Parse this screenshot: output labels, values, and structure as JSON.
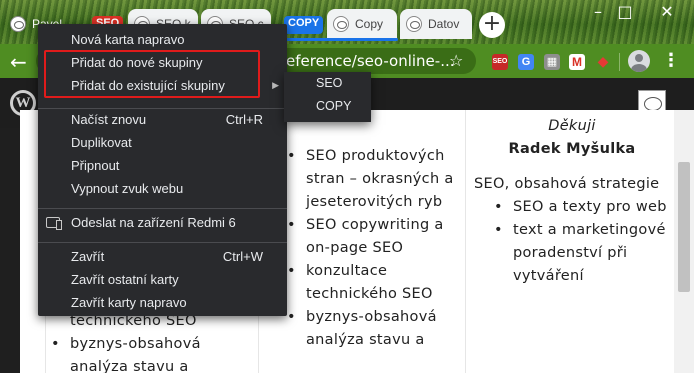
{
  "tabs": {
    "first_title": "Pavel",
    "groups": [
      {
        "label": "SEO",
        "color": "#d93025"
      },
      {
        "label": "COPY",
        "color": "#1a73e8"
      }
    ],
    "titles": [
      "SEO k",
      "SEO c",
      "Copy",
      "Datov"
    ]
  },
  "window": {
    "minimize": "–",
    "maximize": "□",
    "close": "✕"
  },
  "toolbar": {
    "url_fragment": "eference/seo-online-...",
    "back_icon": "arrow-left-icon",
    "star_icon": "star-icon",
    "extensions": [
      {
        "name": "seo-extension",
        "color": "#c62828",
        "label": "SEO"
      },
      {
        "name": "translate-extension",
        "color": "#4285f4",
        "label": "G"
      },
      {
        "name": "color-extension",
        "color": "#8e8e8e",
        "label": "▦"
      },
      {
        "name": "gmail-extension",
        "color": "#ffffff",
        "label": "M"
      },
      {
        "name": "red-extension",
        "color": "#e53935",
        "label": "◆"
      }
    ]
  },
  "context_menu": {
    "items": [
      {
        "label": "Nová karta napravo",
        "shortcut": ""
      },
      {
        "label": "Přidat do nové skupiny",
        "shortcut": ""
      },
      {
        "label": "Přidat do existující skupiny",
        "shortcut": "",
        "submenu": true
      },
      {
        "label": "Načíst znovu",
        "shortcut": "Ctrl+R"
      },
      {
        "label": "Duplikovat",
        "shortcut": ""
      },
      {
        "label": "Připnout",
        "shortcut": ""
      },
      {
        "label": "Vypnout zvuk webu",
        "shortcut": ""
      },
      {
        "label": "Odeslat na zařízení Redmi 6",
        "shortcut": ""
      },
      {
        "label": "Zavřít",
        "shortcut": "Ctrl+W"
      },
      {
        "label": "Zavřít ostatní karty",
        "shortcut": ""
      },
      {
        "label": "Zavřít karty napravo",
        "shortcut": ""
      }
    ],
    "submenu": [
      "SEO",
      "COPY"
    ],
    "highlight_color": "#e01b1b"
  },
  "page": {
    "colA": [
      "technického SEO",
      "byznys-obsahová",
      "analýza stavu a"
    ],
    "colB": [
      "SEO produktových stran – okrasných a jeseterovitých ryb",
      "SEO copywriting a on-page SEO",
      "konzultace technického SEO",
      "byznys-obsahová analýza stavu a"
    ],
    "colC_thanks": "Děkuji",
    "colC_author": "Radek Myšulka",
    "colC_intro": "SEO, obsahová strategie",
    "colC_items": [
      "SEO a texty pro web",
      "text a marketingové poradenství při vytváření"
    ]
  }
}
